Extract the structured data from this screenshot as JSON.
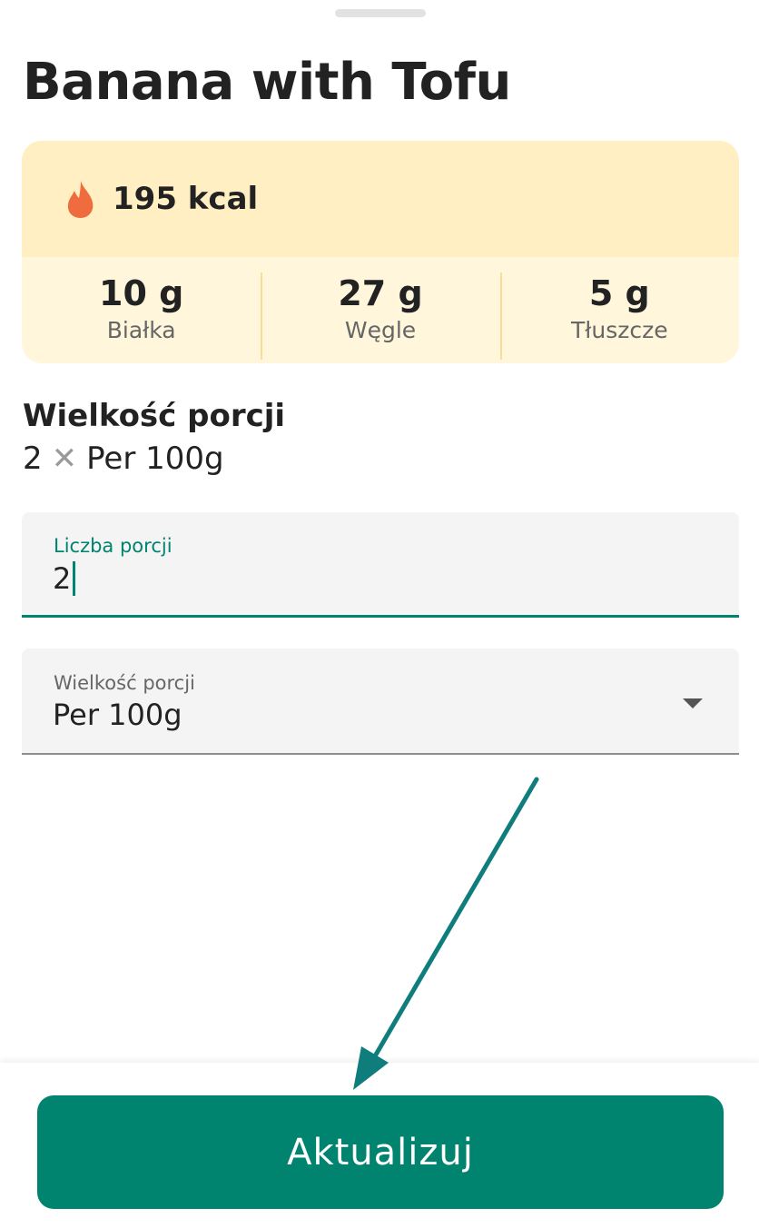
{
  "sheet": {
    "title": "Banana with Tofu"
  },
  "nutrition": {
    "calories": "195 kcal",
    "calorie_icon": "flame-icon",
    "macros": [
      {
        "value": "10 g",
        "label": "Białka"
      },
      {
        "value": "27 g",
        "label": "Węgle"
      },
      {
        "value": "5 g",
        "label": "Tłuszcze"
      }
    ]
  },
  "serving": {
    "heading": "Wielkość porcji",
    "count": "2",
    "times_symbol": "✕",
    "unit": "Per 100g"
  },
  "servings_field": {
    "label": "Liczba porcji",
    "value": "2"
  },
  "size_field": {
    "label": "Wielkość porcji",
    "value": "Per 100g"
  },
  "footer": {
    "update_label": "Aktualizuj"
  },
  "colors": {
    "accent": "#00836f",
    "calorie_band": "#ffefc2",
    "macro_band": "#fff6db",
    "flame": "#ef6c3f"
  }
}
